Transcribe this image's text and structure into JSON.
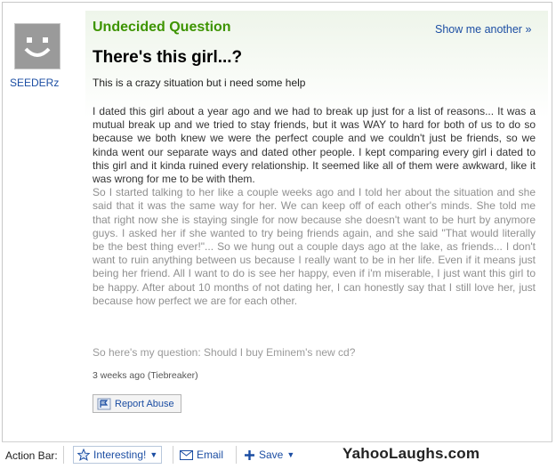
{
  "user": {
    "name": "SEEDERz",
    "avatar_icon": "smiley-avatar-icon"
  },
  "header": {
    "status": "Undecided Question",
    "show_another": "Show me another »"
  },
  "question": {
    "title": "There's this girl...?",
    "subtitle": "This is a crazy situation but i need some help",
    "paragraph1": "I dated this girl about a year ago and we had to break up just for a list of reasons... It was a mutual break up and we tried to stay friends, but it was WAY to hard for both of us to do so because we both knew we were the perfect couple and we couldn't just be friends, so we kinda went our separate ways and dated other people. I kept comparing every girl i dated to this girl and it kinda ruined every relationship. It seemed like all of them were awkward, like it was wrong for me to be with them.",
    "paragraph2": "So I started talking to her like a couple weeks ago and I told her about the situation and she said that it was the same way for her. We can keep off of each other's minds. She told me that right now she is staying single for now because she doesn't want to be hurt by anymore guys. I asked her if she wanted to try being friends again, and she said \"That would literally be the best thing ever!\"... So we hung out a couple days ago at the lake, as friends... I don't want to ruin anything between us because I really want to be in her life. Even if it means just being her friend. All I want to do is see her happy, even if i'm miserable, I just want this girl to be happy. After about 10 months of not dating her, I can honestly say that I still love her, just because how perfect we are for each other.",
    "closing": "So here's my question: Should I buy Eminem's new cd?",
    "meta": "3 weeks ago (Tiebreaker)",
    "report_label": "Report Abuse"
  },
  "action_bar": {
    "label": "Action Bar:",
    "interesting": "Interesting!",
    "email": "Email",
    "save": "Save"
  },
  "watermark": "YahooLaughs.com",
  "colors": {
    "accent_green": "#3d9400",
    "link_blue": "#1c4ea3"
  }
}
